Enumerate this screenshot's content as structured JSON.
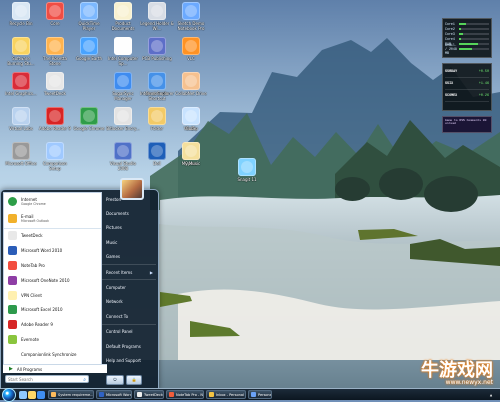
{
  "desktop": {
    "icons": [
      {
        "label": "Recycle Bin",
        "color": "#d9e7f4"
      },
      {
        "label": "Core",
        "color": "#f04d44"
      },
      {
        "label": "QuickTime Player",
        "color": "#7cb8ff"
      },
      {
        "label": "Product Documents",
        "color": "#f8f1d0"
      },
      {
        "label": "Legend Holder & Wi...",
        "color": "#d8dde5"
      },
      {
        "label": "Sketch Demo Notebook Pro",
        "color": "#6ba9ff"
      },
      {
        "label": "Software Burning Stu...",
        "color": "#f9d35f"
      },
      {
        "label": "The Rosetta Stone",
        "color": "#ffb34d"
      },
      {
        "label": "Google Earth",
        "color": "#48a3ff"
      },
      {
        "label": "Intel Computer Sp...",
        "color": "#fefefe"
      },
      {
        "label": "PCB Publishing",
        "color": "#5d6ec8"
      },
      {
        "label": "Intel Graphics...",
        "color": "#d92c38"
      },
      {
        "label": "TweetDeck",
        "color": "#e7e7e7"
      },
      {
        "label": "SugarSync Manager",
        "color": "#3e8cf0"
      },
      {
        "label": "Documents Shortcut",
        "color": "#f1e2a1"
      },
      {
        "label": "CollabNet Drive",
        "color": "#f6c18f"
      },
      {
        "label": "Internet Explorer",
        "color": "#4591e8"
      },
      {
        "label": "Virtual Labs",
        "color": "#b9d2ef"
      },
      {
        "label": "Adobe Reader 9",
        "color": "#d82424"
      },
      {
        "label": "Google Chrome",
        "color": "#2f9d49"
      },
      {
        "label": "Bitlocker Encry...",
        "color": "#e3e3e3"
      },
      {
        "label": "Folder",
        "color": "#f3ca66"
      },
      {
        "label": "WinZip",
        "color": "#ca2930"
      },
      {
        "label": "Microsoft Office",
        "color": "#999"
      },
      {
        "label": "Comparison Setup",
        "color": "#9fc9ff"
      },
      {
        "label": "Visual Studio 2008",
        "color": "#4f71c8"
      },
      {
        "label": "Dell",
        "color": "#1e5fb8"
      },
      {
        "label": "Opera",
        "color": "#da2424"
      },
      {
        "label": "VLC",
        "color": "#ff9223"
      },
      {
        "label": "My Music",
        "color": "#f4df9c"
      },
      {
        "label": "Cube",
        "color": "#c8e3ff"
      },
      {
        "label": "Snagit 11",
        "color": "#5ac2ff"
      }
    ],
    "extra_icon": {
      "label": "Snagit 11",
      "color": "#7fd2ff"
    }
  },
  "gadgets": {
    "cpu": {
      "rows": [
        {
          "label": "Core1",
          "value": 0.23
        },
        {
          "label": "Core2",
          "value": 0.08
        },
        {
          "label": "Core3",
          "value": 0.12
        },
        {
          "label": "Core4",
          "value": 0.07
        },
        {
          "label": "RAM",
          "value": 0.62
        },
        {
          "label": "Avail. / 2048 MB",
          "value": 0.43
        }
      ]
    },
    "stocks": [
      {
        "name": "SSRDAY",
        "change": "+0.50",
        "dir": "up"
      },
      {
        "name": "SSIX",
        "change": "+1.46",
        "dir": "up"
      },
      {
        "name": "SCOMEX",
        "change": "+0.26",
        "dir": "up"
      }
    ],
    "rss_text": "Game to RSS Comments 00 unread"
  },
  "start_menu": {
    "programs": [
      {
        "name": "Internet",
        "sub": "Google Chrome",
        "icon": "chrome-icon",
        "color": "#2d9e48",
        "round": true,
        "pinned": true
      },
      {
        "name": "E-mail",
        "sub": "Microsoft Outlook",
        "icon": "outlook-icon",
        "color": "#f1b12b",
        "round": false,
        "pinned": true
      },
      {
        "name": "TweetDeck",
        "sub": "",
        "icon": "tweetdeck-icon",
        "color": "#e8e8e8",
        "round": false,
        "pinned": false
      },
      {
        "name": "Microsoft Word 2010",
        "sub": "",
        "icon": "word-icon",
        "color": "#2b5db8",
        "round": false,
        "pinned": false
      },
      {
        "name": "NoteTab Pro",
        "sub": "",
        "icon": "notetab-icon",
        "color": "#f24d3f",
        "round": false,
        "pinned": false
      },
      {
        "name": "Microsoft OneNote 2010",
        "sub": "",
        "icon": "onenote-icon",
        "color": "#8e3ea5",
        "round": false,
        "pinned": false
      },
      {
        "name": "VPN Client",
        "sub": "",
        "icon": "vpn-icon",
        "color": "#fff0b0",
        "round": false,
        "pinned": false
      },
      {
        "name": "Microsoft Excel 2010",
        "sub": "",
        "icon": "excel-icon",
        "color": "#2d9a4c",
        "round": false,
        "pinned": false
      },
      {
        "name": "Adobe Reader 9",
        "sub": "",
        "icon": "adobe-reader-icon",
        "color": "#d62626",
        "round": false,
        "pinned": false
      },
      {
        "name": "Evernote",
        "sub": "",
        "icon": "evernote-icon",
        "color": "#8ac53e",
        "round": false,
        "pinned": false
      },
      {
        "name": "Companionlink Synchronize",
        "sub": "",
        "icon": "sync-icon",
        "color": "#ffffff",
        "round": true,
        "pinned": false
      }
    ],
    "all_programs": "All Programs",
    "search_placeholder": "Start Search",
    "right_items": [
      {
        "label": "Preston",
        "arrow": false
      },
      {
        "label": "Documents",
        "arrow": false
      },
      {
        "label": "Pictures",
        "arrow": false
      },
      {
        "label": "Music",
        "arrow": false
      },
      {
        "label": "Games",
        "arrow": false
      },
      {
        "label": "Recent Items",
        "arrow": true
      },
      {
        "label": "Computer",
        "arrow": false
      },
      {
        "label": "Network",
        "arrow": false
      },
      {
        "label": "Connect To",
        "arrow": false
      },
      {
        "label": "Control Panel",
        "arrow": false
      },
      {
        "label": "Default Programs",
        "arrow": false
      },
      {
        "label": "Help and Support",
        "arrow": false
      }
    ]
  },
  "taskbar": {
    "tasks": [
      {
        "label": "System requireme...",
        "color": "#ffbb5c"
      },
      {
        "label": "Microsoft Word",
        "color": "#2f62c4"
      },
      {
        "label": "TweetDeck",
        "color": "#efefef"
      },
      {
        "label": "NoteTab Pro - N...",
        "color": "#f15d3b"
      },
      {
        "label": "Inbox - Personal F...",
        "color": "#f4c342"
      },
      {
        "label": "Personal...",
        "color": "#6ba2f7"
      }
    ],
    "tray": "▲"
  },
  "watermark": {
    "big": "牛游戏网",
    "url": "www.newyx.net"
  }
}
